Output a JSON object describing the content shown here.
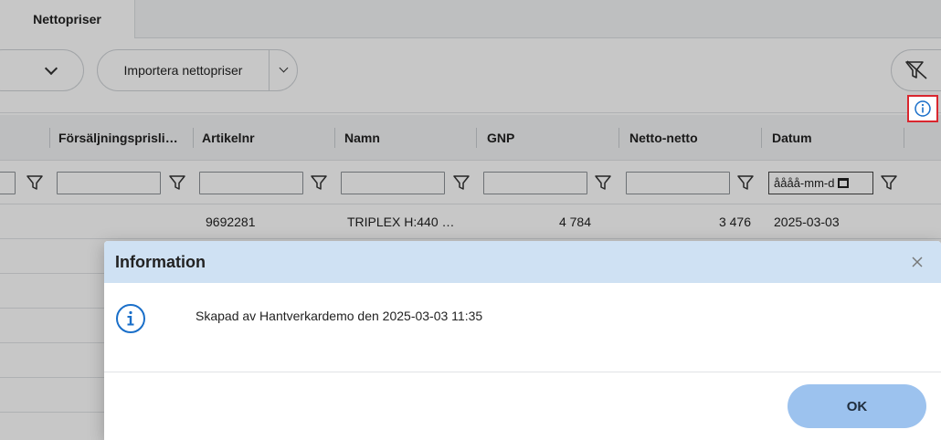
{
  "tabs": [
    {
      "label": "Nettopriser"
    }
  ],
  "toolbar": {
    "import_label": "Importera nettopriser"
  },
  "grid": {
    "columns": [
      "Försäljningsprisli…",
      "Artikelnr",
      "Namn",
      "GNP",
      "Netto-netto",
      "Datum"
    ],
    "date_placeholder": "åååå-mm-d",
    "rows": [
      {
        "artikelnr": "9692281",
        "namn": "TRIPLEX H:440 …",
        "gnp": "4 784",
        "netto_netto": "3 476",
        "datum": "2025-03-03"
      }
    ]
  },
  "modal": {
    "title": "Information",
    "message": "Skapad av Hantverkardemo den 2025-03-03 11:35",
    "ok_label": "OK"
  },
  "colors": {
    "accent": "#1a6fc9",
    "ok_button": "#9cc2ee",
    "modal_header": "#cfe1f3",
    "highlight": "#d9262e"
  },
  "icons": [
    "chevron-down-icon",
    "filter-clear-icon",
    "filter-icon",
    "calendar-icon",
    "info-icon",
    "close-icon"
  ]
}
